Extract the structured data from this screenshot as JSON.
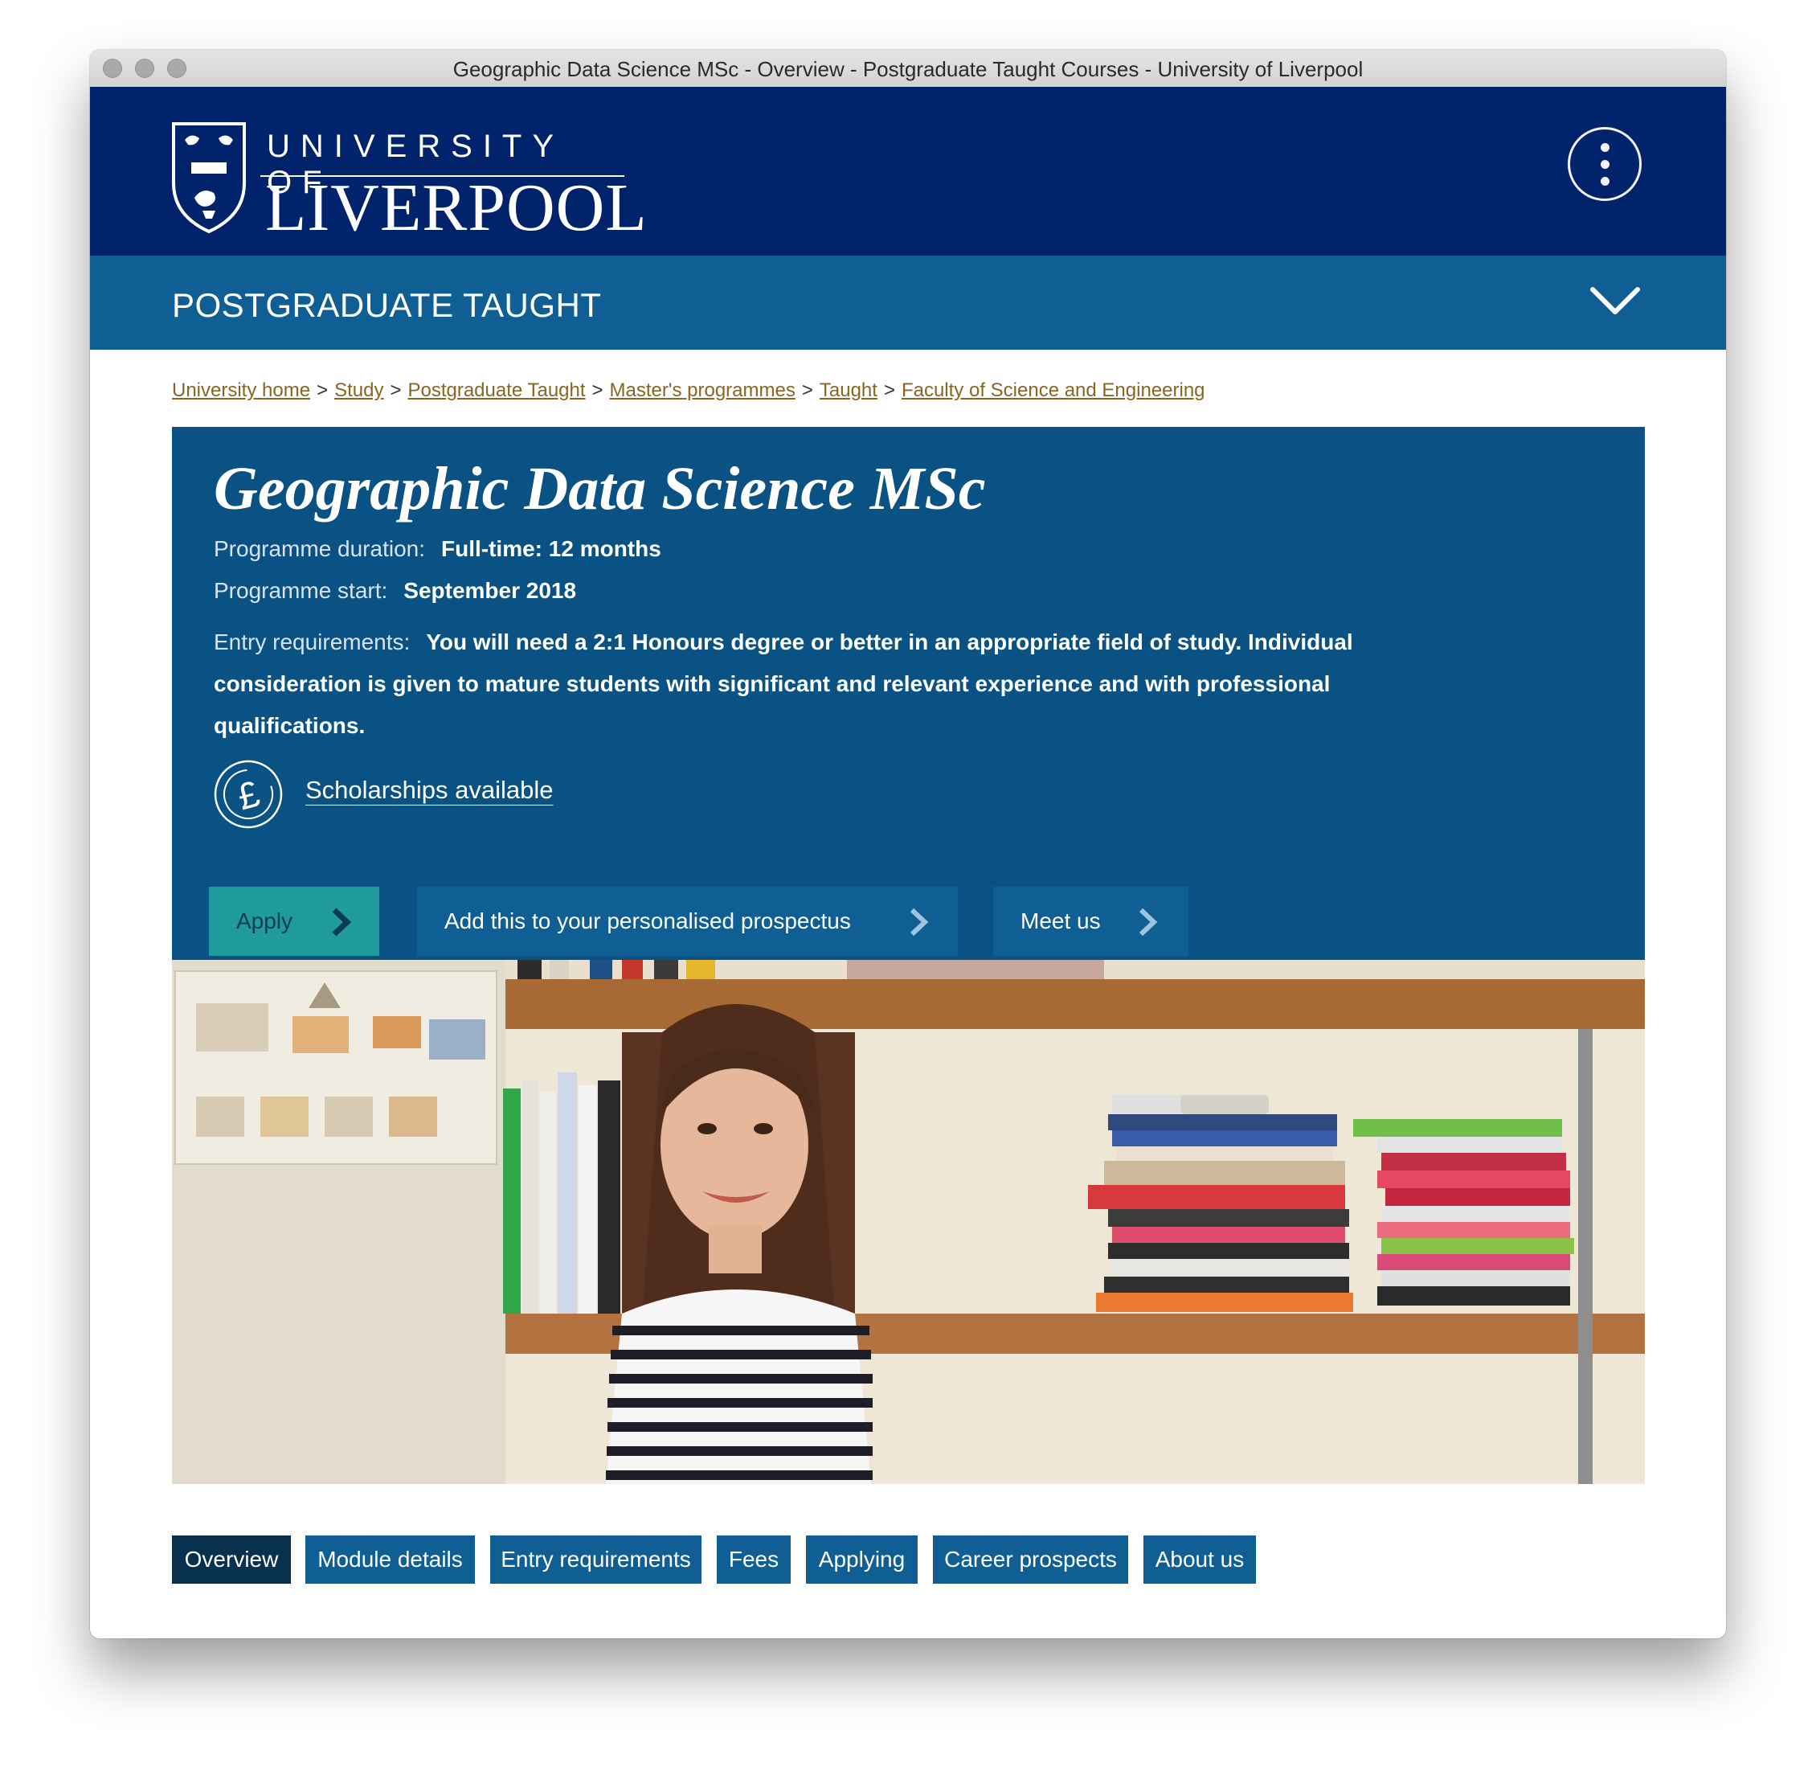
{
  "window": {
    "title": "Geographic Data Science MSc - Overview - Postgraduate Taught Courses - University of Liverpool"
  },
  "header": {
    "logo_top": "UNIVERSITY OF",
    "logo_bottom": "LIVERPOOL",
    "menu_icon": "more-vertical-icon"
  },
  "section_nav": {
    "label": "POSTGRADUATE TAUGHT",
    "toggle_icon": "chevron-down-icon"
  },
  "breadcrumb": [
    "University home",
    "Study",
    "Postgraduate Taught",
    "Master's programmes",
    "Taught",
    "Faculty of Science and Engineering"
  ],
  "course": {
    "title": "Geographic Data Science MSc",
    "duration_label": "Programme duration:",
    "duration_value": "Full-time: 12 months",
    "start_label": "Programme start:",
    "start_value": "September 2018",
    "entry_label": "Entry requirements:",
    "entry_value": "You will need a 2:1 Honours degree or better in an appropriate field of study. Individual consideration is given to mature students with significant and relevant experience and with professional qualifications.",
    "scholarships_link": "Scholarships available",
    "scholarships_icon": "pound-icon"
  },
  "actions": {
    "apply": "Apply",
    "prospectus": "Add this to your personalised prospectus",
    "meet": "Meet us"
  },
  "tabs": [
    "Overview",
    "Module details",
    "Entry requirements",
    "Fees",
    "Applying",
    "Career prospects",
    "About us"
  ],
  "colors": {
    "masthead": "#00236c",
    "section_nav": "#0f5f94",
    "hero_panel": "#0a5283",
    "apply_button": "#1f9b9e",
    "secondary_button": "#0f5f94",
    "active_tab": "#08304f",
    "breadcrumb_link": "#8a6521"
  }
}
